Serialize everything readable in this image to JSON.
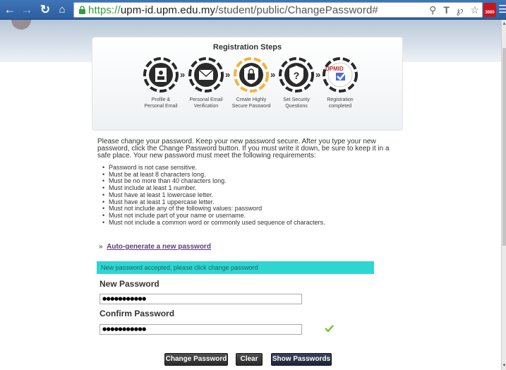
{
  "browser": {
    "url_scheme": "https://",
    "url_host": "upm-id.upm.edu.my",
    "url_path": "/student/public/ChangePassword#",
    "ext_badge": "3080"
  },
  "steps": {
    "title": "Registration Steps",
    "items": [
      {
        "label_1": "Profile &",
        "label_2": "Personal Email",
        "icon": "profile-card-icon",
        "active": false
      },
      {
        "label_1": "Personal Email",
        "label_2": "Verification",
        "icon": "envelope-icon",
        "active": false
      },
      {
        "label_1": "Create Highly",
        "label_2": "Secure Password",
        "icon": "padlock-icon",
        "active": true
      },
      {
        "label_1": "Set Security",
        "label_2": "Questions",
        "icon": "question-shield-icon",
        "active": false
      },
      {
        "label_1": "Registration",
        "label_2": "completed",
        "icon": "upmid-check-icon",
        "active": false
      }
    ],
    "upmid_text": "UPMID"
  },
  "intro": "Please change your password. Keep your new password secure. After you type your new password, click the Change Password button. If you must write it down, be sure to keep it in a safe place. Your new password must meet the following requirements:",
  "requirements": [
    "Password is not case sensitive.",
    "Must be at least 8 characters long.",
    "Must be no more than 40 characters long.",
    "Must include at least 1 number.",
    "Must have at least 1 lowercase letter.",
    "Must have at least 1 uppercase letter.",
    "Must not include any of the following values: password",
    "Must not include part of your name or username.",
    "Must not include a common word or commonly used sequence of characters."
  ],
  "autogen": {
    "prefix": "»",
    "link": "Auto-generate a new password"
  },
  "alert": "New password accepted, please click change password",
  "form": {
    "new_label": "New Password",
    "new_value": "●●●●●●●●●●●",
    "confirm_label": "Confirm Password",
    "confirm_value": "●●●●●●●●●●●"
  },
  "buttons": {
    "change": "Change Password",
    "clear": "Clear",
    "show": "Show Passwords"
  },
  "colors": {
    "active_step": "#f2b43a",
    "alert_bg": "#2ed6d2",
    "chrome_blue": "#3f74b8"
  }
}
